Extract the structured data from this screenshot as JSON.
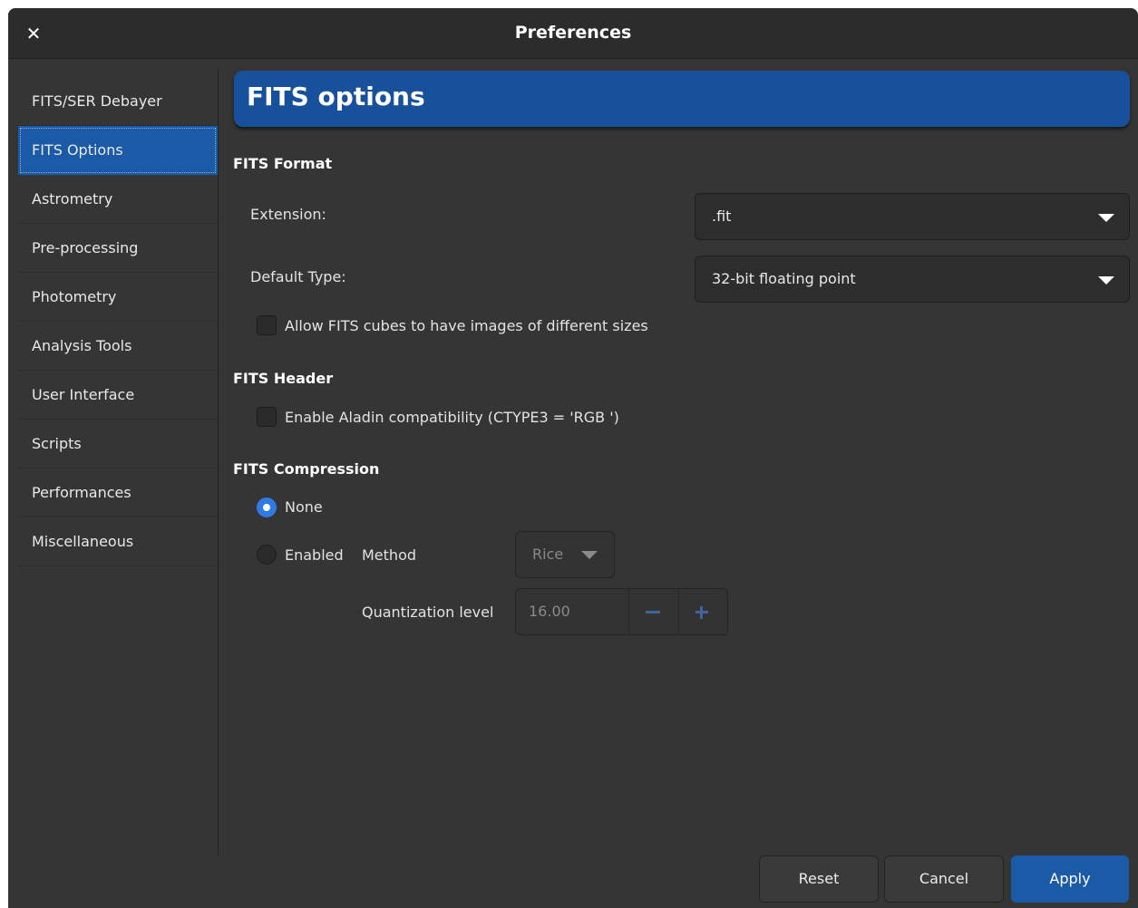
{
  "window": {
    "title": "Preferences",
    "close_glyph": "✕"
  },
  "sidebar": {
    "items": [
      {
        "label": "FITS/SER Debayer"
      },
      {
        "label": "FITS Options"
      },
      {
        "label": "Astrometry"
      },
      {
        "label": "Pre-processing"
      },
      {
        "label": "Photometry"
      },
      {
        "label": "Analysis Tools"
      },
      {
        "label": "User Interface"
      },
      {
        "label": "Scripts"
      },
      {
        "label": "Performances"
      },
      {
        "label": "Miscellaneous"
      }
    ],
    "active_index": 1
  },
  "header": {
    "title": "FITS options"
  },
  "fits_format": {
    "section_title": "FITS Format",
    "extension_label": "Extension:",
    "extension_value": ".fit",
    "default_type_label": "Default Type:",
    "default_type_value": "32-bit floating point",
    "allow_cubes_label": "Allow FITS cubes to have images of different sizes",
    "allow_cubes_checked": false
  },
  "fits_header": {
    "section_title": "FITS Header",
    "aladin_label": "Enable Aladin compatibility (CTYPE3 = 'RGB ')",
    "aladin_checked": false
  },
  "fits_compression": {
    "section_title": "FITS Compression",
    "none_label": "None",
    "none_checked": true,
    "enabled_label": "Enabled",
    "method_label": "Method",
    "method_value": "Rice",
    "quantization_label": "Quantization level",
    "quantization_value": "16.00"
  },
  "buttons": {
    "reset": "Reset",
    "cancel": "Cancel",
    "apply": "Apply"
  },
  "colors": {
    "accent": "#1b5aa6",
    "banner": "#18519b",
    "radio_checked": "#2f7ae5",
    "background": "#353535"
  }
}
